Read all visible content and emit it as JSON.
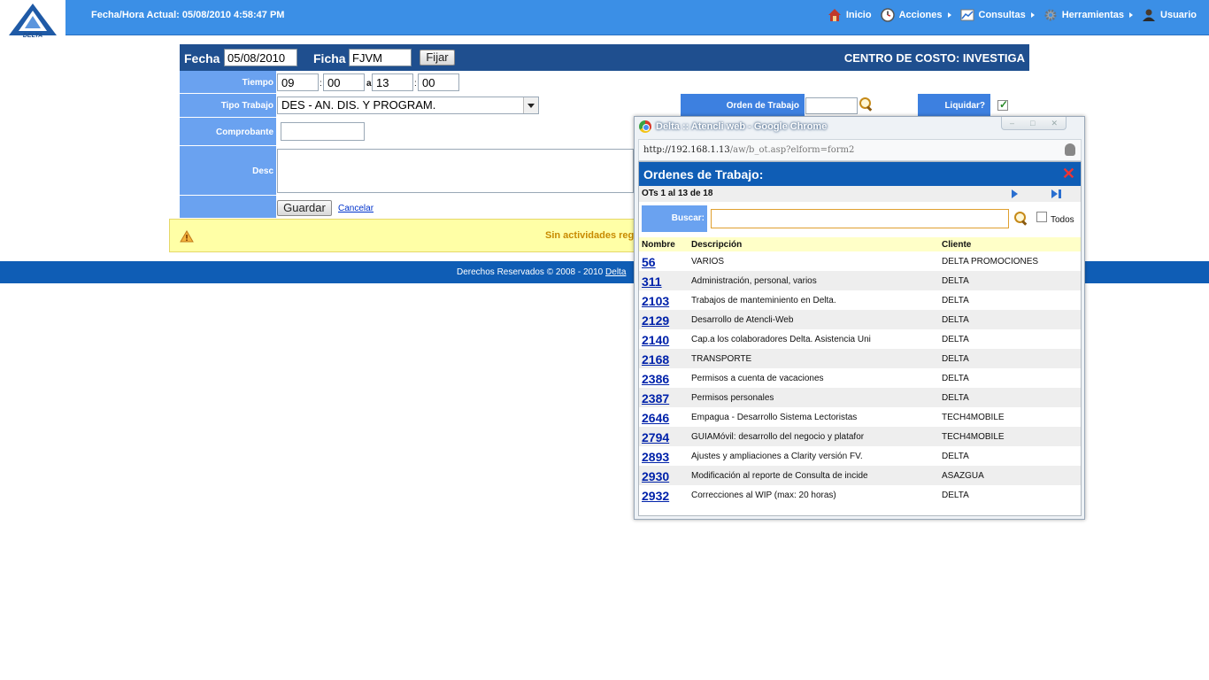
{
  "header": {
    "datetime": "Fecha/Hora Actual: 05/08/2010 4:58:47 PM",
    "logo_text": "DELTA",
    "nav": [
      {
        "label": "Inicio",
        "icon": "home-icon"
      },
      {
        "label": "Acciones",
        "icon": "clock-icon"
      },
      {
        "label": "Consultas",
        "icon": "chart-icon"
      },
      {
        "label": "Herramientas",
        "icon": "gear-icon"
      },
      {
        "label": "Usuario",
        "icon": "user-icon"
      }
    ]
  },
  "form": {
    "fecha_label": "Fecha",
    "fecha_value": "05/08/2010",
    "ficha_label": "Ficha",
    "ficha_value": "FJVM",
    "fijar_label": "Fijar",
    "centro_costo": "CENTRO DE COSTO: INVESTIGA",
    "tiempo_label": "Tiempo",
    "tiempo_h1": "09",
    "tiempo_m1": "00",
    "tiempo_sep_a": "a",
    "tiempo_h2": "13",
    "tiempo_m2": "00",
    "colon": ":",
    "tipo_label": "Tipo Trabajo",
    "tipo_value": "DES - AN. DIS. Y PROGRAM.",
    "orden_label": "Orden de Trabajo",
    "liquidar_label": "Liquidar?",
    "comprobante_label": "Comprobante",
    "desc_label": "Desc",
    "guardar_label": "Guardar",
    "cancelar_label": "Cancelar"
  },
  "warning": {
    "message": "Sin actividades reg"
  },
  "footer": {
    "text": "Derechos Reservados © 2008 - 2010",
    "link": "Delta"
  },
  "popup": {
    "window_title": "Delta :: Atencli web - Google Chrome",
    "url_host": "http://192.168.1.13",
    "url_path": "/aw/b_ot.asp?elform=form2",
    "heading": "Ordenes de Trabajo:",
    "pager_text": "OTs 1 al 13 de 18",
    "search_label": "Buscar:",
    "search_value": "",
    "todos_label": "Todos",
    "columns": {
      "nombre": "Nombre",
      "descripcion": "Descripción",
      "cliente": "Cliente"
    },
    "rows": [
      {
        "nombre": "56",
        "descripcion": "VARIOS",
        "cliente": "DELTA PROMOCIONES"
      },
      {
        "nombre": "311",
        "descripcion": "Administración, personal, varios",
        "cliente": "DELTA"
      },
      {
        "nombre": "2103",
        "descripcion": "Trabajos de manteminiento en Delta.",
        "cliente": "DELTA"
      },
      {
        "nombre": "2129",
        "descripcion": "Desarrollo de Atencli-Web",
        "cliente": "DELTA"
      },
      {
        "nombre": "2140",
        "descripcion": "Cap.a los colaboradores Delta. Asistencia Uni",
        "cliente": "DELTA"
      },
      {
        "nombre": "2168",
        "descripcion": "TRANSPORTE",
        "cliente": "DELTA"
      },
      {
        "nombre": "2386",
        "descripcion": "Permisos a cuenta de vacaciones",
        "cliente": "DELTA"
      },
      {
        "nombre": "2387",
        "descripcion": "Permisos personales",
        "cliente": "DELTA"
      },
      {
        "nombre": "2646",
        "descripcion": "Empagua - Desarrollo Sistema Lectoristas",
        "cliente": "TECH4MOBILE"
      },
      {
        "nombre": "2794",
        "descripcion": "GUIAMóvil: desarrollo del negocio y platafor",
        "cliente": "TECH4MOBILE"
      },
      {
        "nombre": "2893",
        "descripcion": "Ajustes y ampliaciones a Clarity versión FV.",
        "cliente": "DELTA"
      },
      {
        "nombre": "2930",
        "descripcion": "Modificación al reporte de Consulta de incide",
        "cliente": "ASAZGUA"
      },
      {
        "nombre": "2932",
        "descripcion": "Correcciones al WIP (max: 20 horas)",
        "cliente": "DELTA"
      }
    ]
  }
}
